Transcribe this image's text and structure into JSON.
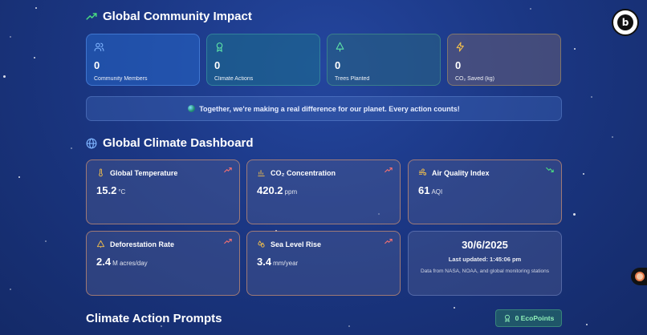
{
  "community": {
    "title": "Global Community Impact",
    "stats": [
      {
        "value": "0",
        "label": "Community Members",
        "icon": "users-icon"
      },
      {
        "value": "0",
        "label": "Climate Actions",
        "icon": "award-icon"
      },
      {
        "value": "0",
        "label": "Trees Planted",
        "icon": "tree-icon"
      },
      {
        "value": "0",
        "label": "CO₂ Saved (kg)",
        "icon": "bolt-icon"
      }
    ],
    "banner": "Together, we're making a real difference for our planet. Every action counts!"
  },
  "dashboard": {
    "title": "Global Climate Dashboard",
    "metrics": [
      {
        "label": "Global Temperature",
        "value": "15.2",
        "unit": "°C",
        "trend": "up"
      },
      {
        "label": "CO₂ Concentration",
        "value": "420.2",
        "unit": "ppm",
        "trend": "up"
      },
      {
        "label": "Air Quality Index",
        "value": "61",
        "unit": "AQI",
        "trend": "down"
      },
      {
        "label": "Deforestation Rate",
        "value": "2.4",
        "unit": "M acres/day",
        "trend": "up"
      },
      {
        "label": "Sea Level Rise",
        "value": "3.4",
        "unit": "mm/year",
        "trend": "up"
      }
    ],
    "date": "30/6/2025",
    "last_updated": "Last updated: 1:45:06 pm",
    "source": "Data from NASA, NOAA, and global monitoring stations"
  },
  "prompts": {
    "title": "Climate Action Prompts",
    "eco_points": "0 EcoPoints"
  },
  "colors": {
    "accent_green": "#4ade80",
    "trend_up": "#f87171",
    "trend_down": "#4ade80",
    "icon_amber": "#f5c04a",
    "icon_blue": "#7fb4ff"
  }
}
